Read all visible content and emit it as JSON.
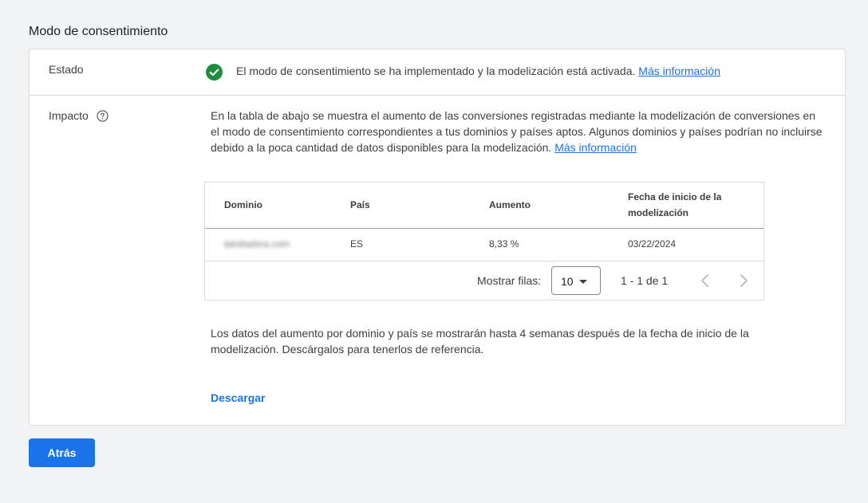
{
  "page": {
    "title": "Modo de consentimiento"
  },
  "status": {
    "label": "Estado",
    "icon": "check-circle-icon",
    "icon_color": "#1e8e3e",
    "text": "El modo de consentimiento se ha implementado y la modelización está activada.",
    "link": "Más información"
  },
  "impact": {
    "label": "Impacto",
    "help_icon": "help-circle-icon",
    "description": "En la tabla de abajo se muestra el aumento de las conversiones registradas mediante la modelización de conversiones en el modo de consentimiento correspondientes a tus dominios y países aptos. Algunos dominios y países podrían no incluirse debido a la poca cantidad de datos disponibles para la modelización.",
    "link": "Más información"
  },
  "table": {
    "headers": {
      "domain": "Dominio",
      "country": "País",
      "lift": "Aumento",
      "start_date": "Fecha de inicio de la modelización"
    },
    "rows": [
      {
        "domain": "latoitadora.com",
        "country": "ES",
        "lift": "8,33 %",
        "start_date": "03/22/2024"
      }
    ],
    "pagination": {
      "rows_label": "Mostrar filas:",
      "rows_value": "10",
      "range": "1 - 1 de 1"
    }
  },
  "note": "Los datos del aumento por dominio y país se mostrarán hasta 4 semanas después de la fecha de inicio de la modelización. Descárgalos para tenerlos de referencia.",
  "download_label": "Descargar",
  "back_button": "Atrás",
  "colors": {
    "accent": "#1a73e8",
    "success": "#1e8e3e",
    "background": "#f1f3f4"
  }
}
